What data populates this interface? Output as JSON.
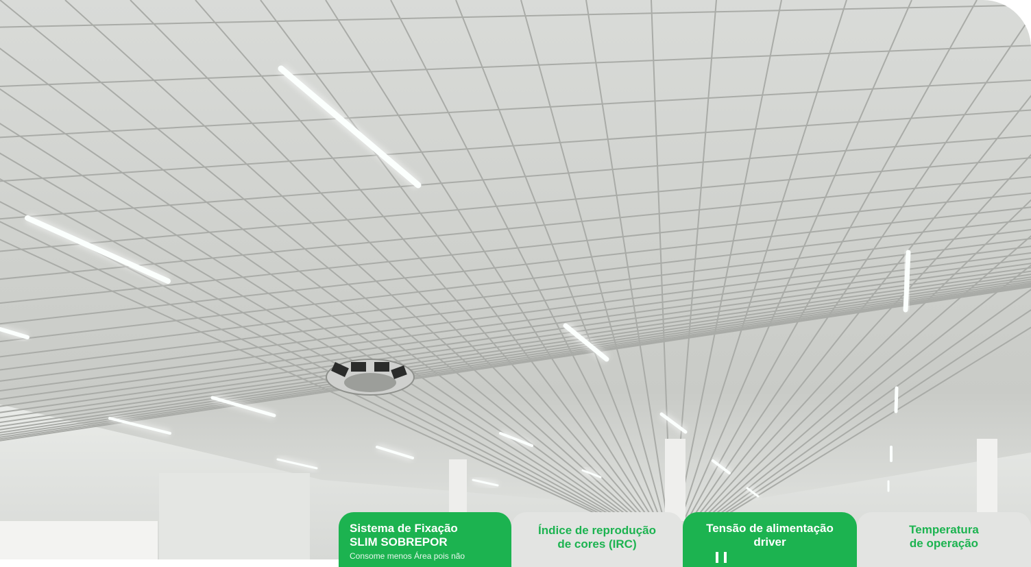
{
  "hero": {
    "image_description_icon": "ceiling-led-lights-photo"
  },
  "tabs": [
    {
      "line1": "Sistema de Fixação",
      "line2": "SLIM SOBREPOR",
      "line3": "Consome menos Área pois não",
      "style": "green"
    },
    {
      "line1": "Índice de reprodução",
      "line2": "de cores (IRC)",
      "style": "grey"
    },
    {
      "line1": "Tensão de alimentação",
      "line2": "driver",
      "icon": "plug-icon",
      "style": "green"
    },
    {
      "line1": "Temperatura",
      "line2": "de operação",
      "style": "grey"
    }
  ],
  "colors": {
    "accent_green": "#1cb350",
    "tab_grey": "#e3e4e2",
    "ceiling": "#d2d4d0"
  }
}
